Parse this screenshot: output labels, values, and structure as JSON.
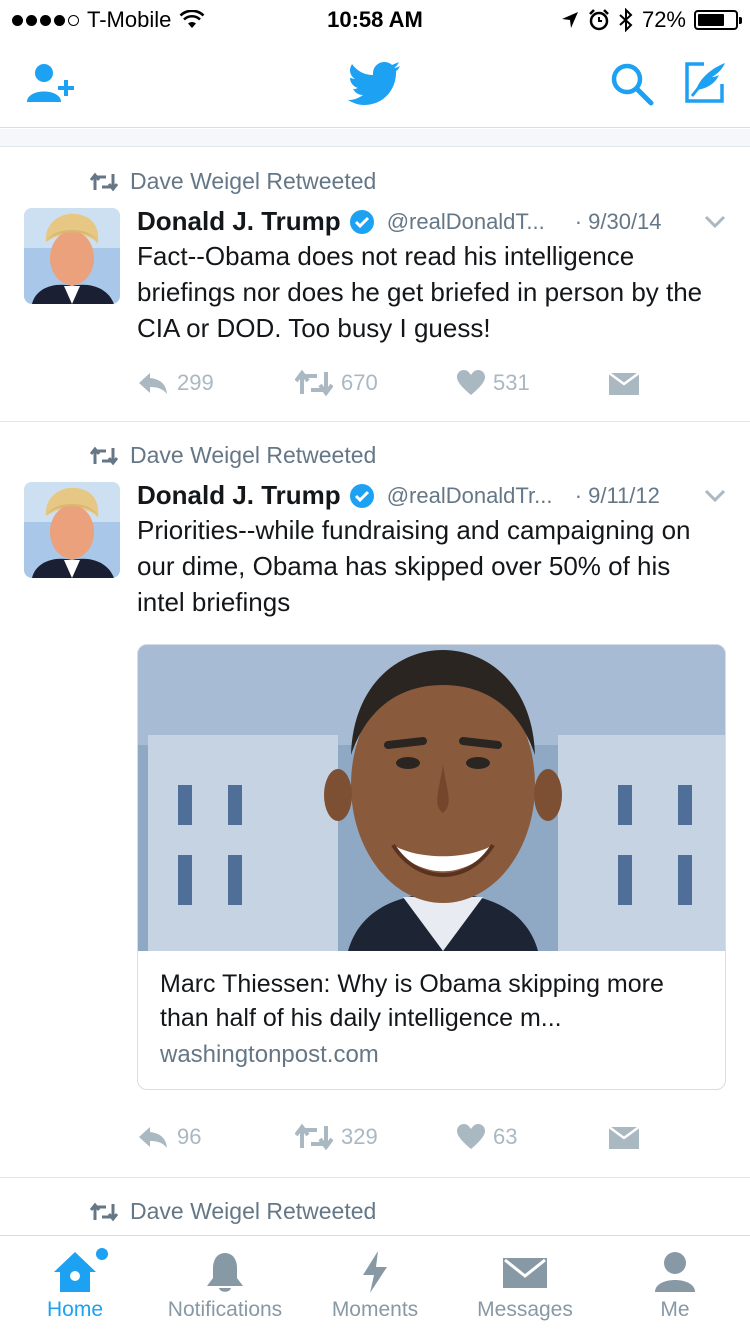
{
  "status_bar": {
    "carrier": "T-Mobile",
    "time": "10:58 AM",
    "battery": "72%",
    "battery_level": 0.72
  },
  "nav": {
    "icons": [
      "add-user-icon",
      "twitter-bird-icon",
      "search-icon",
      "compose-icon"
    ]
  },
  "tweets": [
    {
      "retweeted_by": "Dave Weigel Retweeted",
      "name": "Donald J. Trump",
      "handle": "@realDonaldT...",
      "date": "· 9/30/14",
      "text": "Fact--Obama does not read his intelligence briefings nor does he get briefed in person by the CIA or DOD. Too busy I guess!",
      "replies": "299",
      "retweets": "670",
      "likes": "531"
    },
    {
      "retweeted_by": "Dave Weigel Retweeted",
      "name": "Donald J. Trump",
      "handle": "@realDonaldTr...",
      "date": "· 9/11/12",
      "text": "Priorities--while fundraising and campaigning on our dime, Obama has skipped over 50% of his intel briefings",
      "card": {
        "title": "Marc Thiessen: Why is Obama skipping more than half of his daily intelligence m...",
        "domain": "washingtonpost.com"
      },
      "replies": "96",
      "retweets": "329",
      "likes": "63"
    },
    {
      "retweeted_by": "Dave Weigel Retweeted"
    }
  ],
  "tabs": [
    {
      "label": "Home",
      "icon": "home-icon",
      "active": true
    },
    {
      "label": "Notifications",
      "icon": "bell-icon",
      "active": false
    },
    {
      "label": "Moments",
      "icon": "lightning-icon",
      "active": false
    },
    {
      "label": "Messages",
      "icon": "envelope-icon",
      "active": false
    },
    {
      "label": "Me",
      "icon": "person-icon",
      "active": false
    }
  ],
  "colors": {
    "accent": "#1da1f2",
    "muted": "#657786",
    "action": "#aab8c2"
  }
}
